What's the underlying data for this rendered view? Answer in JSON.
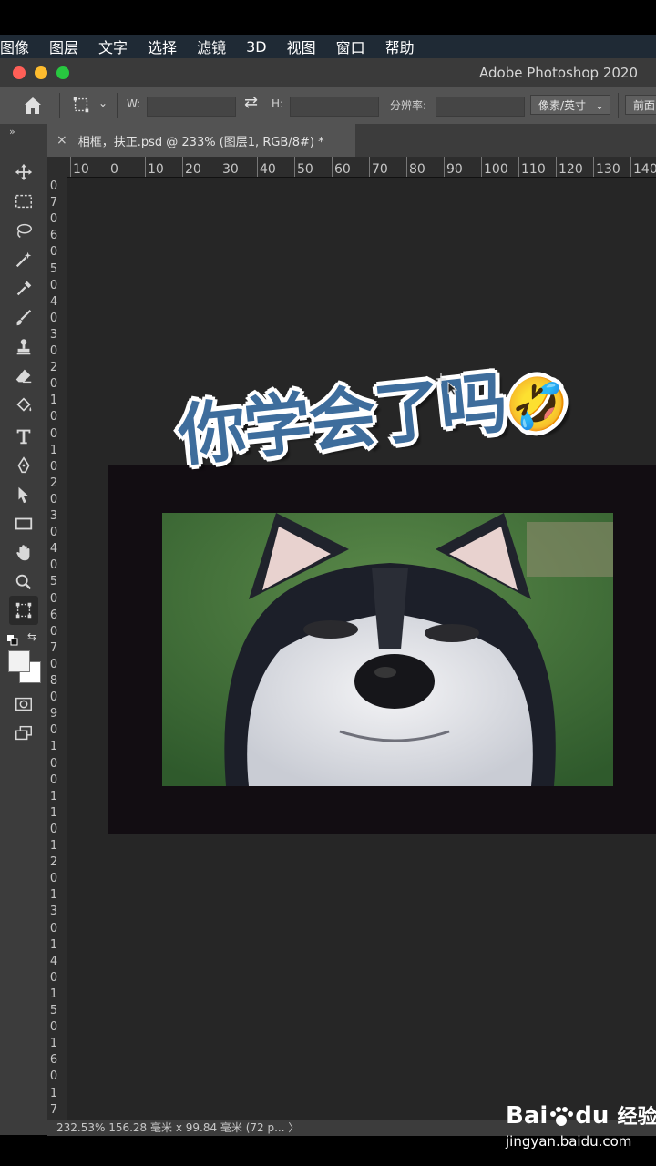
{
  "menu": [
    "图像",
    "图层",
    "文字",
    "选择",
    "滤镜",
    "3D",
    "视图",
    "窗口",
    "帮助"
  ],
  "app_title": "Adobe Photoshop 2020",
  "options": {
    "w_label": "W:",
    "h_label": "H:",
    "resolution_label": "分辨率:",
    "unit_select": "像素/英寸",
    "front_button": "前面"
  },
  "panel_collapse": "»",
  "doc_tab": {
    "close": "×",
    "title": "相框，扶正.psd @ 233% (图层1, RGB/8#) *"
  },
  "ruler_h": [
    "10",
    "0",
    "10",
    "20",
    "30",
    "40",
    "50",
    "60",
    "70",
    "80",
    "90",
    "100",
    "110",
    "120",
    "130",
    "140"
  ],
  "ruler_v": [
    "0",
    "7",
    "0",
    "6",
    "0",
    "5",
    "0",
    "4",
    "0",
    "3",
    "0",
    "2",
    "0",
    "1",
    "0",
    "0",
    "1",
    "0",
    "2",
    "0",
    "3",
    "0",
    "4",
    "0",
    "5",
    "0",
    "6",
    "0",
    "7",
    "0",
    "8",
    "0",
    "9",
    "0",
    "1",
    "0",
    "0",
    "1",
    "1",
    "0",
    "1",
    "2",
    "0",
    "1",
    "3",
    "0",
    "1",
    "4",
    "0",
    "1",
    "5",
    "0",
    "1",
    "6",
    "0",
    "1",
    "7"
  ],
  "overlay_text": "你学会了吗",
  "overlay_emoji": "🤣",
  "status": "232.53%   156.28 毫米 x 99.84 毫米 (72 p...  〉",
  "watermark": {
    "brand": "Bai",
    "brand2": "du",
    "suffix": "经验",
    "url": "jingyan.baidu.com"
  }
}
